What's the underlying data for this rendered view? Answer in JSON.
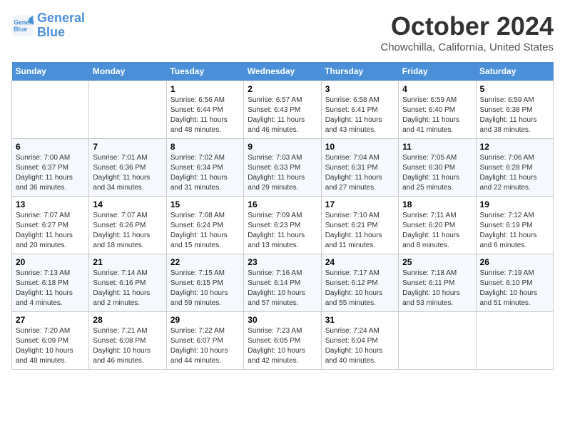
{
  "logo": {
    "line1": "General",
    "line2": "Blue"
  },
  "title": "October 2024",
  "subtitle": "Chowchilla, California, United States",
  "days_header": [
    "Sunday",
    "Monday",
    "Tuesday",
    "Wednesday",
    "Thursday",
    "Friday",
    "Saturday"
  ],
  "weeks": [
    [
      {
        "day": "",
        "info": ""
      },
      {
        "day": "",
        "info": ""
      },
      {
        "day": "1",
        "info": "Sunrise: 6:56 AM\nSunset: 6:44 PM\nDaylight: 11 hours and 48 minutes."
      },
      {
        "day": "2",
        "info": "Sunrise: 6:57 AM\nSunset: 6:43 PM\nDaylight: 11 hours and 46 minutes."
      },
      {
        "day": "3",
        "info": "Sunrise: 6:58 AM\nSunset: 6:41 PM\nDaylight: 11 hours and 43 minutes."
      },
      {
        "day": "4",
        "info": "Sunrise: 6:59 AM\nSunset: 6:40 PM\nDaylight: 11 hours and 41 minutes."
      },
      {
        "day": "5",
        "info": "Sunrise: 6:59 AM\nSunset: 6:38 PM\nDaylight: 11 hours and 38 minutes."
      }
    ],
    [
      {
        "day": "6",
        "info": "Sunrise: 7:00 AM\nSunset: 6:37 PM\nDaylight: 11 hours and 36 minutes."
      },
      {
        "day": "7",
        "info": "Sunrise: 7:01 AM\nSunset: 6:36 PM\nDaylight: 11 hours and 34 minutes."
      },
      {
        "day": "8",
        "info": "Sunrise: 7:02 AM\nSunset: 6:34 PM\nDaylight: 11 hours and 31 minutes."
      },
      {
        "day": "9",
        "info": "Sunrise: 7:03 AM\nSunset: 6:33 PM\nDaylight: 11 hours and 29 minutes."
      },
      {
        "day": "10",
        "info": "Sunrise: 7:04 AM\nSunset: 6:31 PM\nDaylight: 11 hours and 27 minutes."
      },
      {
        "day": "11",
        "info": "Sunrise: 7:05 AM\nSunset: 6:30 PM\nDaylight: 11 hours and 25 minutes."
      },
      {
        "day": "12",
        "info": "Sunrise: 7:06 AM\nSunset: 6:28 PM\nDaylight: 11 hours and 22 minutes."
      }
    ],
    [
      {
        "day": "13",
        "info": "Sunrise: 7:07 AM\nSunset: 6:27 PM\nDaylight: 11 hours and 20 minutes."
      },
      {
        "day": "14",
        "info": "Sunrise: 7:07 AM\nSunset: 6:26 PM\nDaylight: 11 hours and 18 minutes."
      },
      {
        "day": "15",
        "info": "Sunrise: 7:08 AM\nSunset: 6:24 PM\nDaylight: 11 hours and 15 minutes."
      },
      {
        "day": "16",
        "info": "Sunrise: 7:09 AM\nSunset: 6:23 PM\nDaylight: 11 hours and 13 minutes."
      },
      {
        "day": "17",
        "info": "Sunrise: 7:10 AM\nSunset: 6:21 PM\nDaylight: 11 hours and 11 minutes."
      },
      {
        "day": "18",
        "info": "Sunrise: 7:11 AM\nSunset: 6:20 PM\nDaylight: 11 hours and 8 minutes."
      },
      {
        "day": "19",
        "info": "Sunrise: 7:12 AM\nSunset: 6:19 PM\nDaylight: 11 hours and 6 minutes."
      }
    ],
    [
      {
        "day": "20",
        "info": "Sunrise: 7:13 AM\nSunset: 6:18 PM\nDaylight: 11 hours and 4 minutes."
      },
      {
        "day": "21",
        "info": "Sunrise: 7:14 AM\nSunset: 6:16 PM\nDaylight: 11 hours and 2 minutes."
      },
      {
        "day": "22",
        "info": "Sunrise: 7:15 AM\nSunset: 6:15 PM\nDaylight: 10 hours and 59 minutes."
      },
      {
        "day": "23",
        "info": "Sunrise: 7:16 AM\nSunset: 6:14 PM\nDaylight: 10 hours and 57 minutes."
      },
      {
        "day": "24",
        "info": "Sunrise: 7:17 AM\nSunset: 6:12 PM\nDaylight: 10 hours and 55 minutes."
      },
      {
        "day": "25",
        "info": "Sunrise: 7:18 AM\nSunset: 6:11 PM\nDaylight: 10 hours and 53 minutes."
      },
      {
        "day": "26",
        "info": "Sunrise: 7:19 AM\nSunset: 6:10 PM\nDaylight: 10 hours and 51 minutes."
      }
    ],
    [
      {
        "day": "27",
        "info": "Sunrise: 7:20 AM\nSunset: 6:09 PM\nDaylight: 10 hours and 48 minutes."
      },
      {
        "day": "28",
        "info": "Sunrise: 7:21 AM\nSunset: 6:08 PM\nDaylight: 10 hours and 46 minutes."
      },
      {
        "day": "29",
        "info": "Sunrise: 7:22 AM\nSunset: 6:07 PM\nDaylight: 10 hours and 44 minutes."
      },
      {
        "day": "30",
        "info": "Sunrise: 7:23 AM\nSunset: 6:05 PM\nDaylight: 10 hours and 42 minutes."
      },
      {
        "day": "31",
        "info": "Sunrise: 7:24 AM\nSunset: 6:04 PM\nDaylight: 10 hours and 40 minutes."
      },
      {
        "day": "",
        "info": ""
      },
      {
        "day": "",
        "info": ""
      }
    ]
  ]
}
